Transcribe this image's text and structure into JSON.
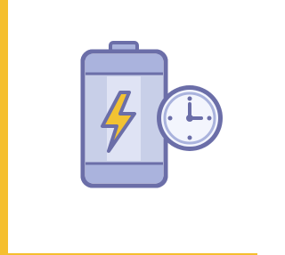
{
  "icon": {
    "name": "battery-charging-clock-icon",
    "parts": [
      "battery-icon",
      "lightning-bolt-icon",
      "clock-icon"
    ]
  },
  "colors": {
    "accent": "#f5bf2e",
    "outline": "#6b6ea8",
    "battery_band": "#aab3dd",
    "battery_fill": "#c8cfe8",
    "battery_highlight": "#e9ecf8",
    "bolt": "#f2c232",
    "clock_face": "#f3f5fd"
  }
}
